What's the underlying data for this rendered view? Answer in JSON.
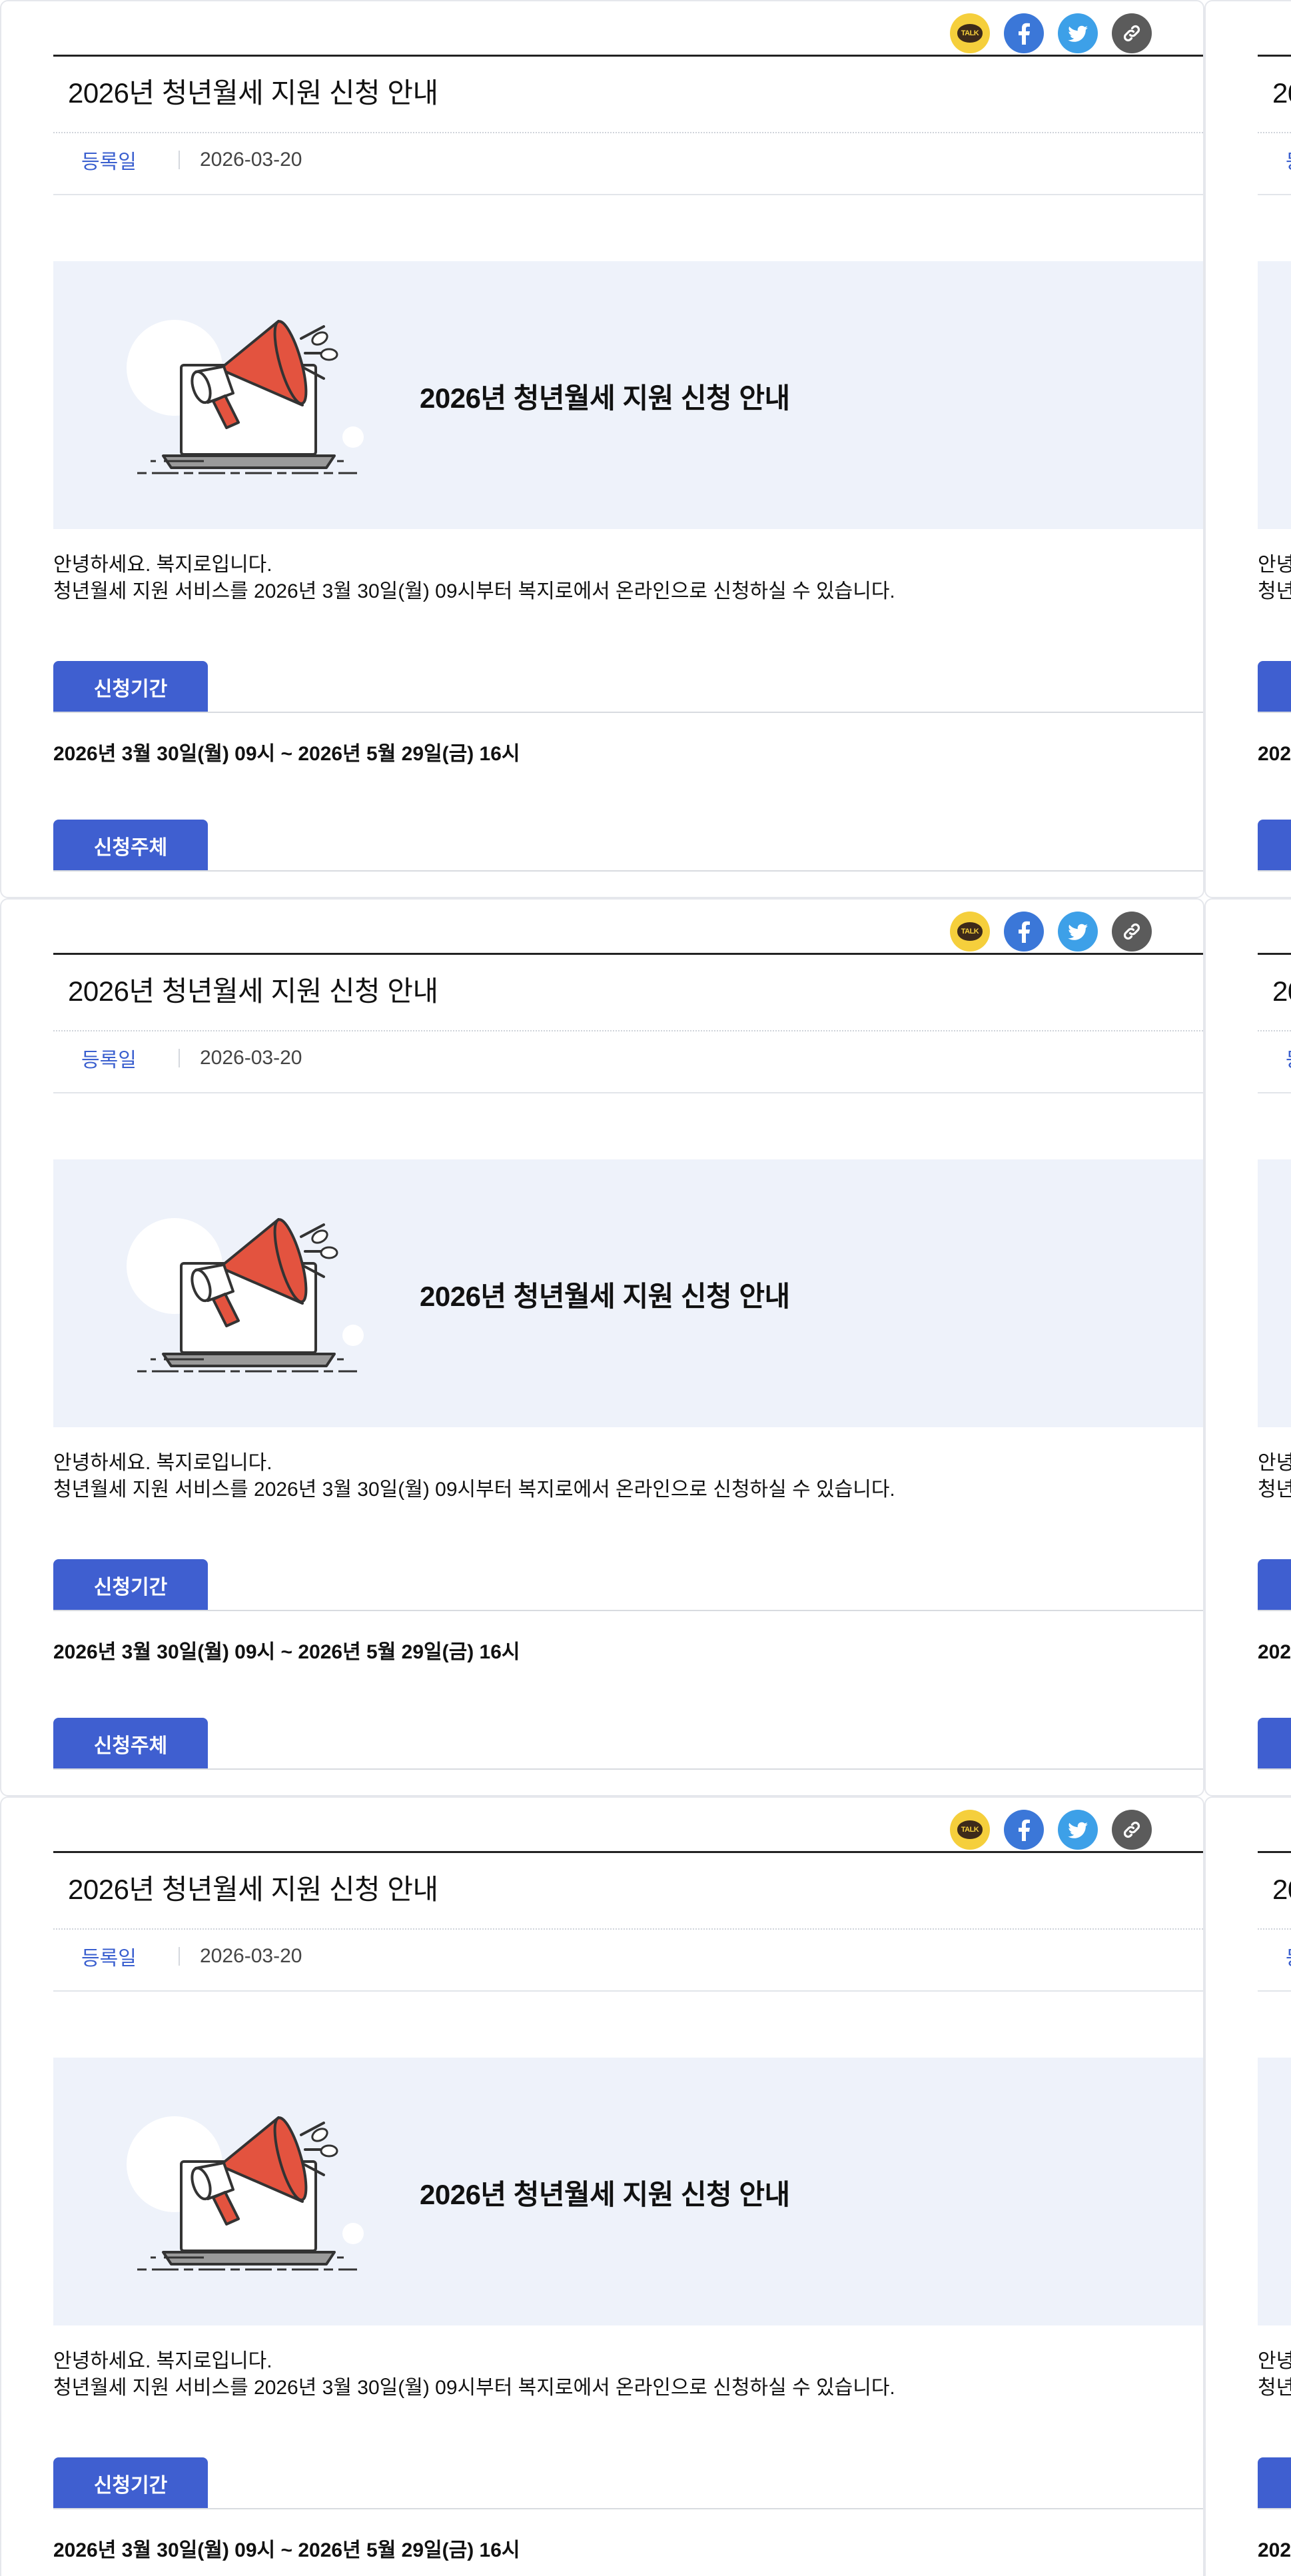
{
  "share": {
    "kakao_label": "TALK",
    "icons": [
      "kakaotalk-icon",
      "facebook-icon",
      "twitter-icon",
      "link-icon"
    ]
  },
  "post": {
    "title": "2026년 청년월세 지원 신청 안내",
    "date_label": "등록일",
    "date_value": "2026-03-20"
  },
  "banner": {
    "title": "2026년 청년월세 지원 신청 안내",
    "illustration": "megaphone-laptop-illustration"
  },
  "body": {
    "greeting_line1": "안녕하세요. 복지로입니다.",
    "greeting_line2": "청년월세 지원 서비스를 2026년 3월 30일(월) 09시부터 복지로에서 온라인으로 신청하실 수 있습니다."
  },
  "sections": {
    "period_label": "신청기간",
    "period_text": "2026년 3월 30일(월) 09시 ~ 2026년 5월 29일(금) 16시",
    "subject_label": "신청주체"
  },
  "colors": {
    "accent": "#3f5fd0",
    "banner_bg": "#eef2fa",
    "kakao": "#f5cf3c",
    "facebook": "#3b77d8",
    "twitter": "#3da0e8",
    "link": "#5b5b5b"
  }
}
